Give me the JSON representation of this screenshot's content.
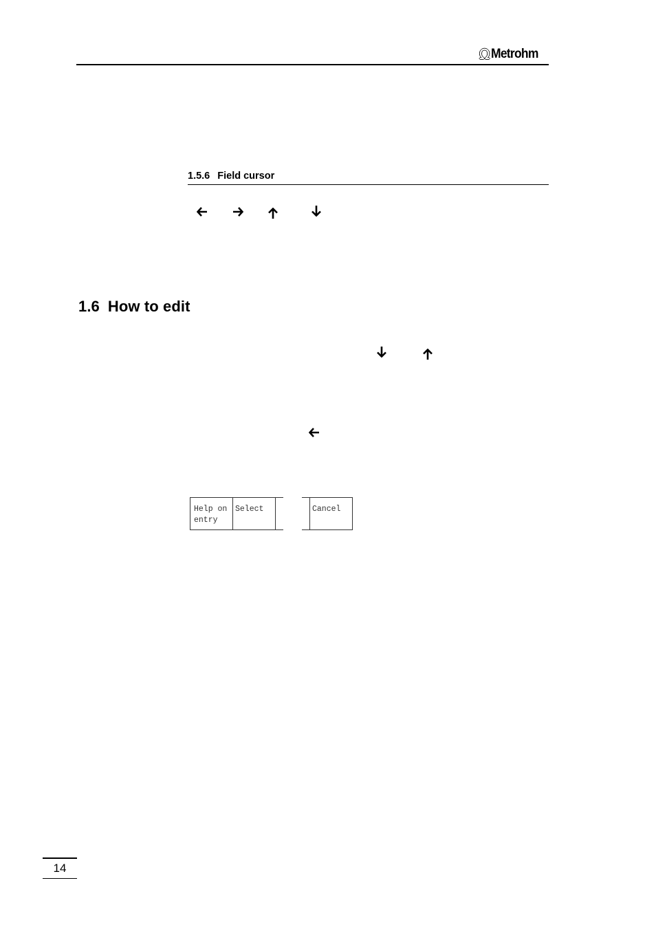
{
  "header": {
    "brand": "Metrohm",
    "brand_icon": "omega-icon"
  },
  "subsection": {
    "number": "1.5.6",
    "title": "Field cursor",
    "arrow_keys": [
      {
        "icon": "arrow-left-icon",
        "glyph": "🡐"
      },
      {
        "icon": "arrow-right-icon",
        "glyph": "🡒"
      },
      {
        "icon": "arrow-up-icon",
        "glyph": "🡑"
      },
      {
        "icon": "arrow-down-icon",
        "glyph": "🡓"
      }
    ]
  },
  "section": {
    "number": "1.6",
    "title": "How to edit",
    "inline_arrows": [
      {
        "icon": "arrow-down-icon",
        "glyph": "🡓"
      },
      {
        "icon": "arrow-up-icon",
        "glyph": "🡑"
      },
      {
        "icon": "arrow-left-icon",
        "glyph": "🡐"
      }
    ]
  },
  "softkeys": [
    {
      "line1": "Help on",
      "line2": "entry"
    },
    {
      "line1": "Select",
      "line2": ""
    },
    {
      "line1": "",
      "line2": ""
    },
    {
      "line1": "Cancel",
      "line2": ""
    }
  ],
  "footer": {
    "page_number": "14"
  }
}
